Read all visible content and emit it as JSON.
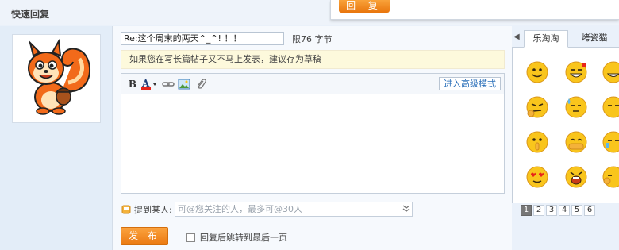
{
  "header": {
    "title": "快速回复"
  },
  "popup": {
    "reply_label": "回 复"
  },
  "form": {
    "subject_value": "Re:这个周末的两天^_^! ！！",
    "limit_text": "限76 字节",
    "tip_text": "如果您在写长篇帖子又不马上发表，建议存为草稿",
    "advanced_label": "进入高级模式",
    "mention_label": "提到某人:",
    "mention_placeholder": "可@您关注的人，最多可@30人",
    "submit_label": "发 布",
    "jump_label": "回复后跳转到最后一页"
  },
  "emoticons": {
    "tabs": [
      "乐淘淘",
      "烤瓷猫"
    ],
    "pages": [
      "1",
      "2",
      "3",
      "4",
      "5",
      "6"
    ],
    "active_page": "1"
  },
  "colors": {
    "accent": "#f08a1c",
    "link": "#2a6fb9",
    "tip_bg": "#fdf9dc"
  },
  "icons": [
    "squirrel-avatar",
    "bold-icon",
    "font-color-icon",
    "link-icon",
    "image-icon",
    "attachment-icon",
    "mention-icon",
    "chevron-down-icon",
    "arrow-left-icon"
  ]
}
